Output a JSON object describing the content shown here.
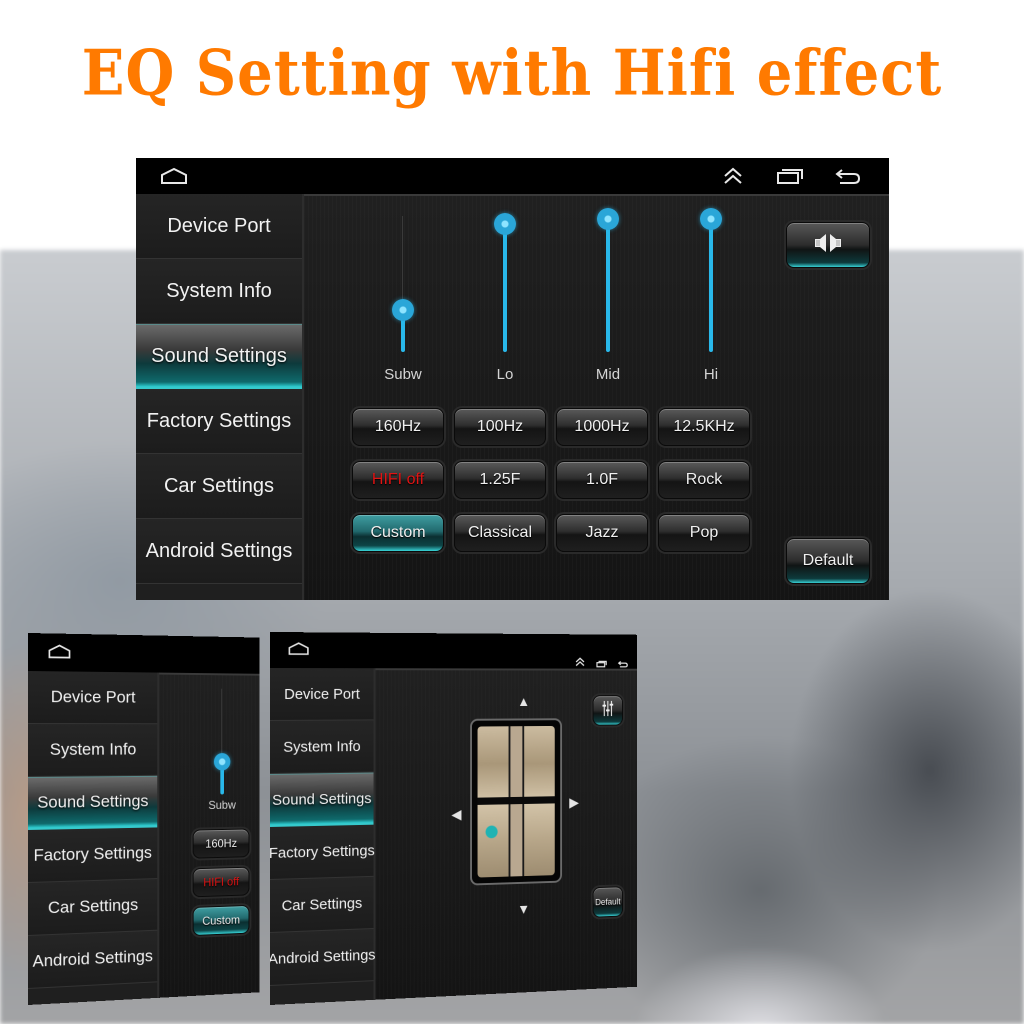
{
  "headline": "EQ Setting with Hifi effect",
  "colors": {
    "headline": "#ff7a00",
    "accent_teal": "#37c9cc",
    "slider_blue": "#29b8ea",
    "hifi_off_red": "#e01414"
  },
  "navbar": {
    "home_icon": "home-icon",
    "up_icon": "double-chevron-up-icon",
    "recents_icon": "recent-apps-icon",
    "back_icon": "back-icon"
  },
  "sidebar": {
    "items": [
      {
        "label": "Device Port"
      },
      {
        "label": "System Info"
      },
      {
        "label": "Sound Settings",
        "active": true
      },
      {
        "label": "Factory Settings"
      },
      {
        "label": "Car Settings"
      },
      {
        "label": "Android Settings"
      }
    ]
  },
  "eq": {
    "sliders": [
      {
        "label": "Subw",
        "level_percent": 31
      },
      {
        "label": "Lo",
        "level_percent": 94
      },
      {
        "label": "Mid",
        "level_percent": 98
      },
      {
        "label": "Hi",
        "level_percent": 98
      }
    ],
    "buttons": {
      "row1": [
        "160Hz",
        "100Hz",
        "1000Hz",
        "12.5KHz"
      ],
      "row2": [
        "HIFI off",
        "1.25F",
        "1.0F",
        "Rock"
      ],
      "row3": [
        "Custom",
        "Classical",
        "Jazz",
        "Pop"
      ]
    },
    "selected_preset": "Custom",
    "speaker_balance_icon": "speaker-balance-icon",
    "default_label": "Default"
  },
  "balance_screen": {
    "eq_icon": "equalizer-icon",
    "default_label": "Default",
    "arrows": [
      "up-arrow-icon",
      "down-arrow-icon",
      "left-arrow-icon",
      "right-arrow-icon"
    ]
  }
}
